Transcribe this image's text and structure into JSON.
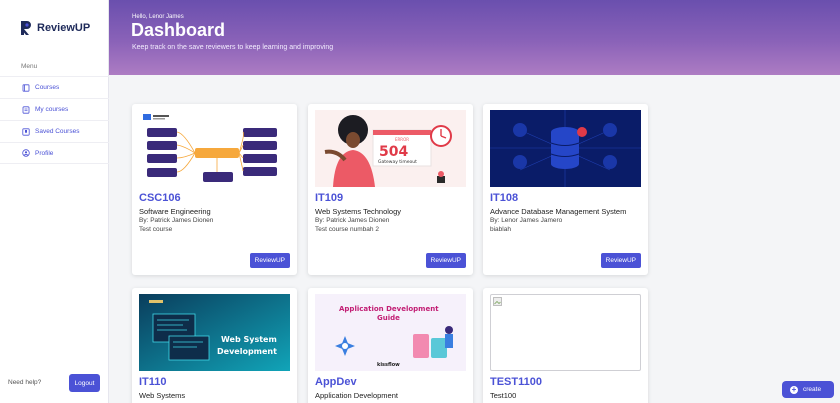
{
  "brand": {
    "name": "ReviewUP"
  },
  "sidebar": {
    "menu_title": "Menu",
    "items": [
      {
        "label": "Courses",
        "icon": "book-icon"
      },
      {
        "label": "My courses",
        "icon": "notebook-icon"
      },
      {
        "label": "Saved Courses",
        "icon": "bookmark-icon"
      },
      {
        "label": "Profile",
        "icon": "user-circle-icon"
      }
    ],
    "need_help": "Need help?",
    "logout": "Logout"
  },
  "header": {
    "greeting": "Hello, Lenor James",
    "title": "Dashboard",
    "subtitle": "Keep track on the save reviewers to keep learning and improving"
  },
  "cards": [
    {
      "code": "CSC106",
      "name": "Software Engineering",
      "author": "By: Patrick James Dionen",
      "description": "Test course",
      "button": "ReviewUP"
    },
    {
      "code": "IT109",
      "name": "Web Systems Technology",
      "author": "By: Patrick James Dionen",
      "description": "Test course numbah 2",
      "button": "ReviewUP",
      "image_text": {
        "error": "ERROR",
        "code": "504",
        "message": "Gateway timeout"
      }
    },
    {
      "code": "IT108",
      "name": "Advance Database Management System",
      "author": "By: Lenor James Jamero",
      "description": "biablah",
      "button": "ReviewUP"
    },
    {
      "code": "IT110",
      "name": "Web Systems",
      "image_text": {
        "line1": "Web System",
        "line2": "Development"
      }
    },
    {
      "code": "AppDev",
      "name": "Application Development",
      "image_text": {
        "line1": "Application Development",
        "line2": "Guide",
        "brand": "kissflow"
      }
    },
    {
      "code": "TEST1100",
      "name": "Test100"
    }
  ],
  "create_button": {
    "label": "create"
  },
  "colors": {
    "accent": "#4b52d6",
    "header_start": "#6a4fae",
    "header_end": "#ad7cc3"
  }
}
